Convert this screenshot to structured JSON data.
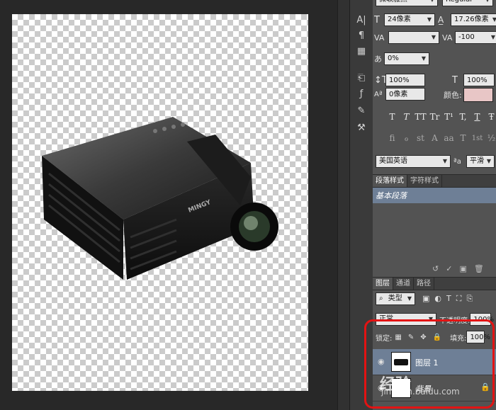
{
  "colors": {
    "panel_bg": "#535353",
    "tool_bg": "#3a3a3a",
    "color_swatch": "#e8c6c6",
    "selection": "#6e7f96",
    "highlight": "#e31313"
  },
  "projector": {
    "brand": "MINGY"
  },
  "character_panel": {
    "font_family": "微软雅黑",
    "font_style": "Regular",
    "size": "24像素",
    "leading": "17.26像素",
    "kerning": "",
    "tracking": "-100",
    "tsume": "0%",
    "v_scale": "100%",
    "h_scale": "100%",
    "baseline": "0像素",
    "color_label": "颜色:",
    "language": "美国英语",
    "aa_label": "ªa",
    "antialias": "平滑",
    "style_buttons": [
      "T",
      "T",
      "TT",
      "Tr",
      "T¹",
      "T,",
      "T",
      "Ŧ"
    ],
    "ot_buttons": [
      "fi",
      "ℴ",
      "st",
      "A",
      "aa",
      "T",
      "1st",
      "½"
    ]
  },
  "styles_panel": {
    "tab1": "段落样式",
    "tab2": "字符样式",
    "item": "基本段落"
  },
  "layers_panel": {
    "tab1": "图层",
    "tab2": "通道",
    "tab3": "路径",
    "filter": "类型",
    "blend_mode": "正常",
    "opacity_label": "不透明度:",
    "opacity": "100%",
    "lock_label": "锁定:",
    "fill_label": "填充:",
    "fill": "100%",
    "layers": [
      {
        "name": "图层 1"
      },
      {
        "name": "背景"
      }
    ]
  },
  "watermark": {
    "text": "经验",
    "url": "jingyan.baidu.com"
  }
}
